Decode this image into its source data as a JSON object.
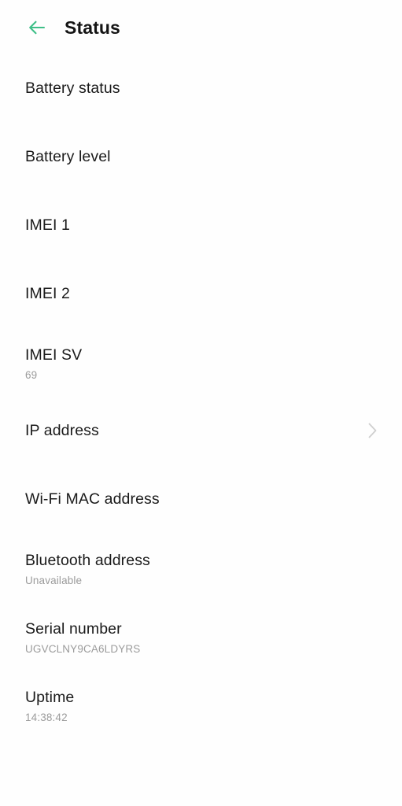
{
  "app": {
    "background_color": "#fefefe",
    "accent_color": "#3fbf88",
    "title_color": "#141414",
    "subtitle_color": "#9b9b9b",
    "chevron_color": "#cfcfcf"
  },
  "header": {
    "title": "Status",
    "back_icon": "arrow-left-icon"
  },
  "list": {
    "items": [
      {
        "title": "Battery status",
        "value": null,
        "chevron": false
      },
      {
        "title": "Battery level",
        "value": null,
        "chevron": false
      },
      {
        "title": "IMEI 1",
        "value": null,
        "chevron": false
      },
      {
        "title": "IMEI 2",
        "value": null,
        "chevron": false
      },
      {
        "title": "IMEI SV",
        "value": "69",
        "chevron": false
      },
      {
        "title": "IP address",
        "value": null,
        "chevron": true
      },
      {
        "title": "Wi-Fi MAC address",
        "value": null,
        "chevron": false
      },
      {
        "title": "Bluetooth address",
        "value": "Unavailable",
        "chevron": false
      },
      {
        "title": "Serial number",
        "value": "UGVCLNY9CA6LDYRS",
        "chevron": false
      },
      {
        "title": "Uptime",
        "value": "14:38:42",
        "chevron": false
      }
    ]
  }
}
